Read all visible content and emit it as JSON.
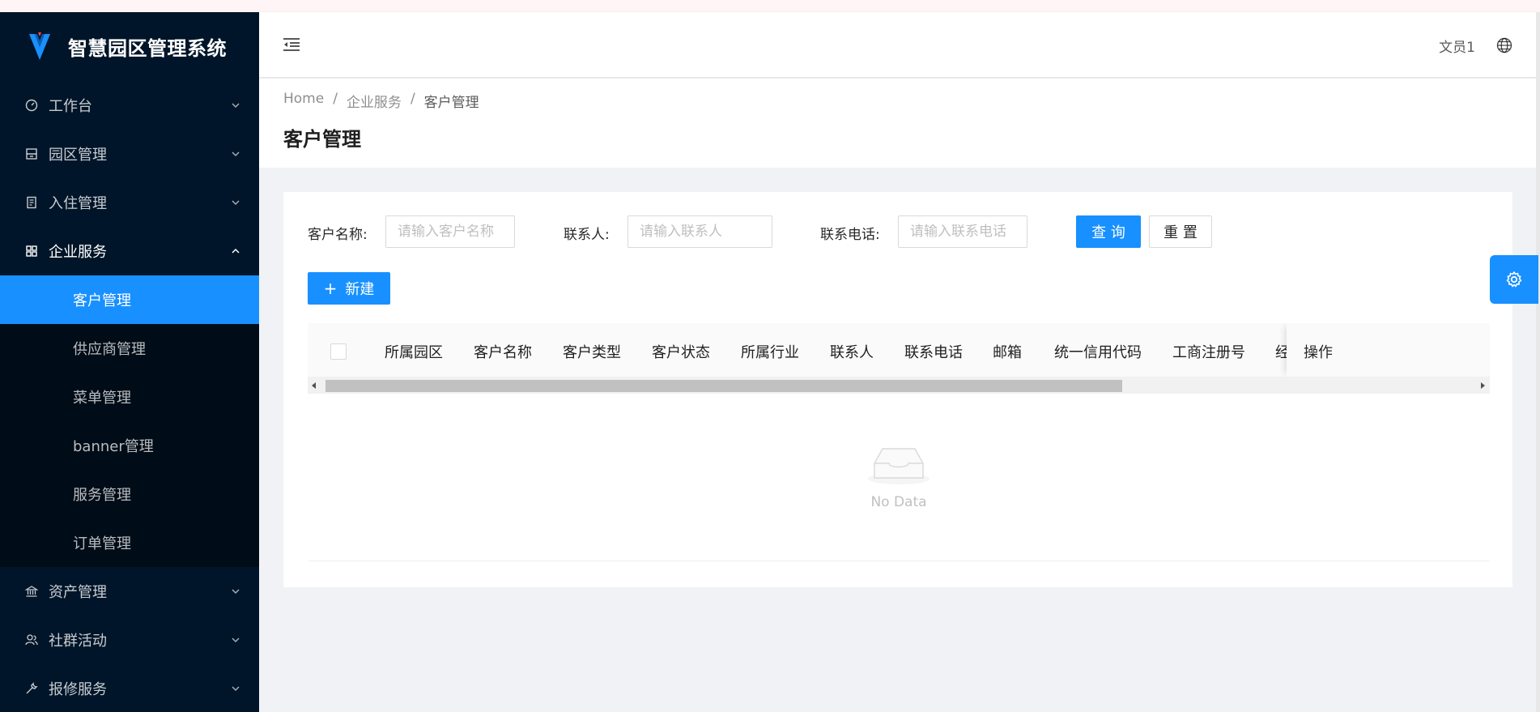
{
  "app": {
    "title": "智慧园区管理系统"
  },
  "sidebar": {
    "items": [
      {
        "label": "工作台",
        "icon": "dashboard-icon",
        "open": false
      },
      {
        "label": "园区管理",
        "icon": "building-icon",
        "open": false
      },
      {
        "label": "入住管理",
        "icon": "form-icon",
        "open": false
      },
      {
        "label": "企业服务",
        "icon": "appstore-icon",
        "open": true,
        "children": [
          "客户管理",
          "供应商管理",
          "菜单管理",
          "banner管理",
          "服务管理",
          "订单管理"
        ]
      },
      {
        "label": "资产管理",
        "icon": "bank-icon",
        "open": false
      },
      {
        "label": "社群活动",
        "icon": "team-icon",
        "open": false
      },
      {
        "label": "报修服务",
        "icon": "tool-icon",
        "open": false
      }
    ]
  },
  "header": {
    "user": "文员1"
  },
  "breadcrumb": [
    "Home",
    "企业服务",
    "客户管理"
  ],
  "page": {
    "title": "客户管理"
  },
  "search": {
    "customer_name_label": "客户名称:",
    "customer_name_placeholder": "请输入客户名称",
    "contact_label": "联系人:",
    "contact_placeholder": "请输入联系人",
    "phone_label": "联系电话:",
    "phone_placeholder": "请输入联系电话",
    "query_btn": "查 询",
    "reset_btn": "重 置"
  },
  "toolbar": {
    "new_btn": "新建"
  },
  "table": {
    "columns": [
      "所属园区",
      "客户名称",
      "客户类型",
      "客户状态",
      "所属行业",
      "联系人",
      "联系电话",
      "邮箱",
      "统一信用代码",
      "工商注册号",
      "经"
    ],
    "action_column": "操作",
    "empty_text": "No Data"
  },
  "colors": {
    "primary": "#1890ff",
    "sider": "#001529",
    "sider_sub": "#000c17"
  }
}
